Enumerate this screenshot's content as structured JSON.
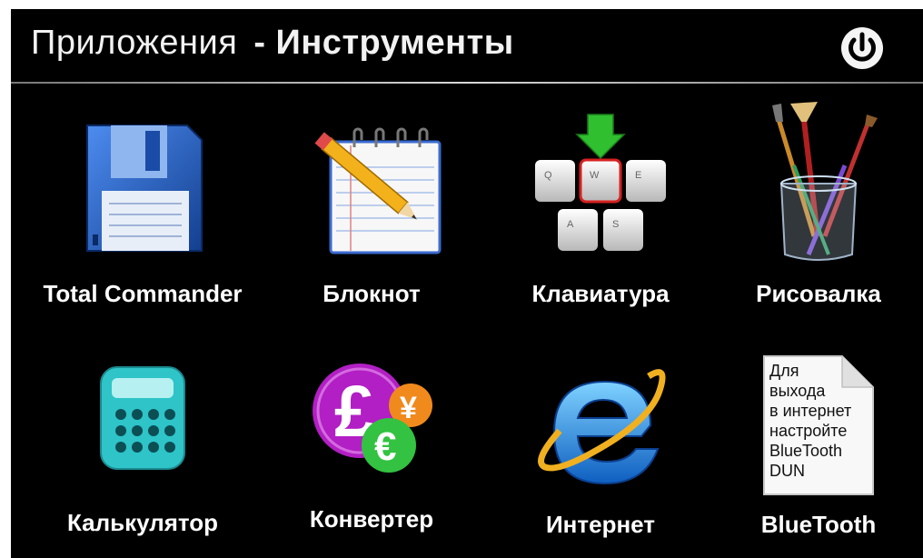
{
  "header": {
    "title_part1": "Приложения",
    "title_part2": "- Инструменты",
    "power_icon": "power-icon"
  },
  "apps": [
    {
      "label": "Total Commander",
      "icon": "floppy-disk-icon"
    },
    {
      "label": "Блокнот",
      "icon": "notepad-pencil-icon"
    },
    {
      "label": "Клавиатура",
      "icon": "keyboard-keys-icon"
    },
    {
      "label": "Рисовалка",
      "icon": "paint-brushes-icon"
    },
    {
      "label": "Калькулятор",
      "icon": "calculator-icon"
    },
    {
      "label": "Конвертер",
      "icon": "currency-converter-icon"
    },
    {
      "label": "Интернет",
      "icon": "internet-explorer-icon"
    },
    {
      "label": "BlueTooth",
      "icon": "bluetooth-note-icon"
    }
  ],
  "keyboard_keys": [
    "Q",
    "W",
    "E",
    "A",
    "S"
  ],
  "converter_symbols": [
    "£",
    "¥",
    "€"
  ],
  "bluetooth_note_lines": [
    "Для",
    "выхода",
    "в интернет",
    "настройте",
    "BlueTooth",
    "DUN"
  ],
  "colors": {
    "background": "#000000",
    "text": "#ffffff",
    "floppy": "#1f5fc4",
    "calculator": "#2ec4c8",
    "converter_pound": "#b21fc4",
    "converter_euro": "#33c241",
    "converter_yen": "#f08a1c",
    "ie_blue": "#1a7fe0",
    "key_highlight": "#d62020",
    "arrow": "#2fbf2f"
  }
}
